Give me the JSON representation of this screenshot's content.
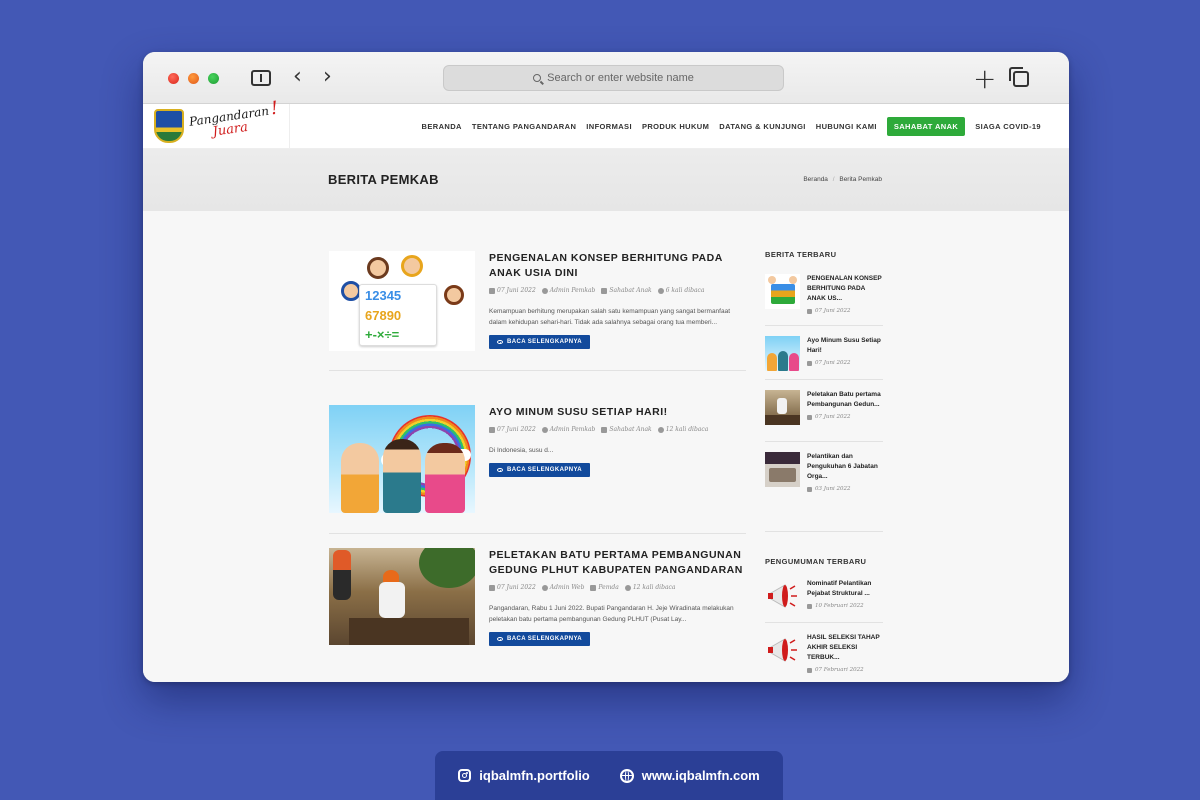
{
  "browser": {
    "url_placeholder": "Search or enter website name"
  },
  "site": {
    "logo_text_line1": "Pangandaran",
    "logo_text_line2": "Juara",
    "logo_text_bang": "!",
    "nav": [
      {
        "label": "BERANDA"
      },
      {
        "label": "TENTANG PANGANDARAN"
      },
      {
        "label": "INFORMASI"
      },
      {
        "label": "PRODUK HUKUM"
      },
      {
        "label": "DATANG & KUNJUNGI"
      },
      {
        "label": "HUBUNGI KAMI"
      },
      {
        "label": "SAHABAT ANAK"
      },
      {
        "label": "SIAGA COVID-19"
      }
    ]
  },
  "page": {
    "title": "BERITA PEMKAB",
    "breadcrumb": [
      "Beranda",
      "Berita Pemkab"
    ],
    "breadcrumb_sep": "/"
  },
  "articles": [
    {
      "title": "PENGENALAN KONSEP BERHITUNG PADA ANAK USIA DINI",
      "date": "07 Juni 2022",
      "author": "Admin Pemkab",
      "category": "Sahabat Anak",
      "views": "6 kali dibaca",
      "excerpt": "Kemampuan berhitung merupakan salah satu kemampuan yang sangat bermanfaat dalam kehidupan sehari-hari. Tidak ada salahnya sebagai orang tua memberi...",
      "button": "BACA SELENGKAPNYA",
      "image_numbers": [
        "12345",
        "67890",
        "+-×÷="
      ]
    },
    {
      "title": "AYO MINUM SUSU SETIAP HARI!",
      "date": "07 Juni 2022",
      "author": "Admin Pemkab",
      "category": "Sahabat Anak",
      "views": "12 kali dibaca",
      "excerpt": "Di Indonesia, susu d...",
      "button": "BACA SELENGKAPNYA"
    },
    {
      "title": "PELETAKAN BATU PERTAMA PEMBANGUNAN GEDUNG PLHUT KABUPATEN PANGANDARAN",
      "date": "07 Juni 2022",
      "author": "Admin Web",
      "category": "Pemda",
      "views": "12 kali dibaca",
      "excerpt": "Pangandaran, Rabu 1 Juni 2022. Bupati Pangandaran H. Jeje Wiradinata melakukan peletakan batu pertama pembangunan Gedung PLHUT (Pusat Lay...",
      "button": "BACA SELENGKAPNYA"
    }
  ],
  "sidebar": {
    "latest_news_heading": "BERITA TERBARU",
    "latest_news": [
      {
        "title": "PENGENALAN KONSEP BERHITUNG PADA ANAK US...",
        "date": "07 Juni 2022"
      },
      {
        "title": "Ayo Minum Susu Setiap Hari!",
        "date": "07 Juni 2022"
      },
      {
        "title": "Peletakan Batu pertama Pembangunan Gedun...",
        "date": "07 Juni 2022"
      },
      {
        "title": "Pelantikan dan Pengukuhan 6 Jabatan Orga...",
        "date": "03 Juni 2022"
      }
    ],
    "announcements_heading": "PENGUMUMAN TERBARU",
    "announcements": [
      {
        "title": "Nominatif Pelantikan Pejabat Struktural ...",
        "date": "10 Februari 2022"
      },
      {
        "title": "HASIL SELEKSI TAHAP AKHIR SELEKSI TERBUK...",
        "date": "07 Februari 2022"
      }
    ]
  },
  "footer": {
    "instagram": "iqbalmfn.portfolio",
    "website": "www.iqbalmfn.com"
  },
  "colors": {
    "background": "#4358b5",
    "button_blue": "#124a9c",
    "nav_highlight": "#2eaa3a",
    "footer_badge": "#2b3f96"
  }
}
